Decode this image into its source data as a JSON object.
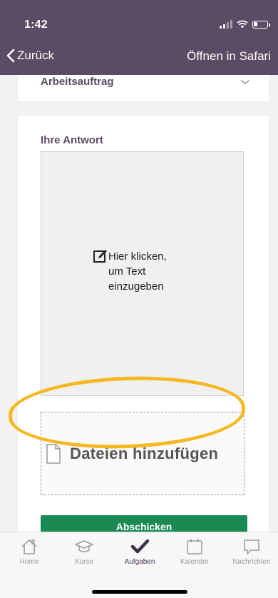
{
  "status_bar": {
    "time": "1:42"
  },
  "nav": {
    "back_label": "Zurück",
    "safari_label": "Öffnen in Safari"
  },
  "assignment": {
    "title": "Arbeitsauftrag"
  },
  "answer": {
    "title": "Ihre Antwort",
    "editor_prompt": [
      "Hier klicken,",
      "um Text",
      "einzugeben"
    ],
    "dropzone_label": "Dateien hinzufügen",
    "submit_label": "Abschicken"
  },
  "tabs": [
    {
      "label": "Home",
      "icon": "home-icon"
    },
    {
      "label": "Kurse",
      "icon": "graduation-cap-icon"
    },
    {
      "label": "Aufgaben",
      "icon": "checkmark-icon"
    },
    {
      "label": "Kalender",
      "icon": "calendar-icon"
    },
    {
      "label": "Nachrichten",
      "icon": "chat-icon"
    }
  ],
  "colors": {
    "header_bg": "#5b4b64",
    "accent_text": "#5b4b64",
    "submit_bg": "#1a8a52",
    "highlight": "#f5b722"
  },
  "active_tab": "Aufgaben"
}
